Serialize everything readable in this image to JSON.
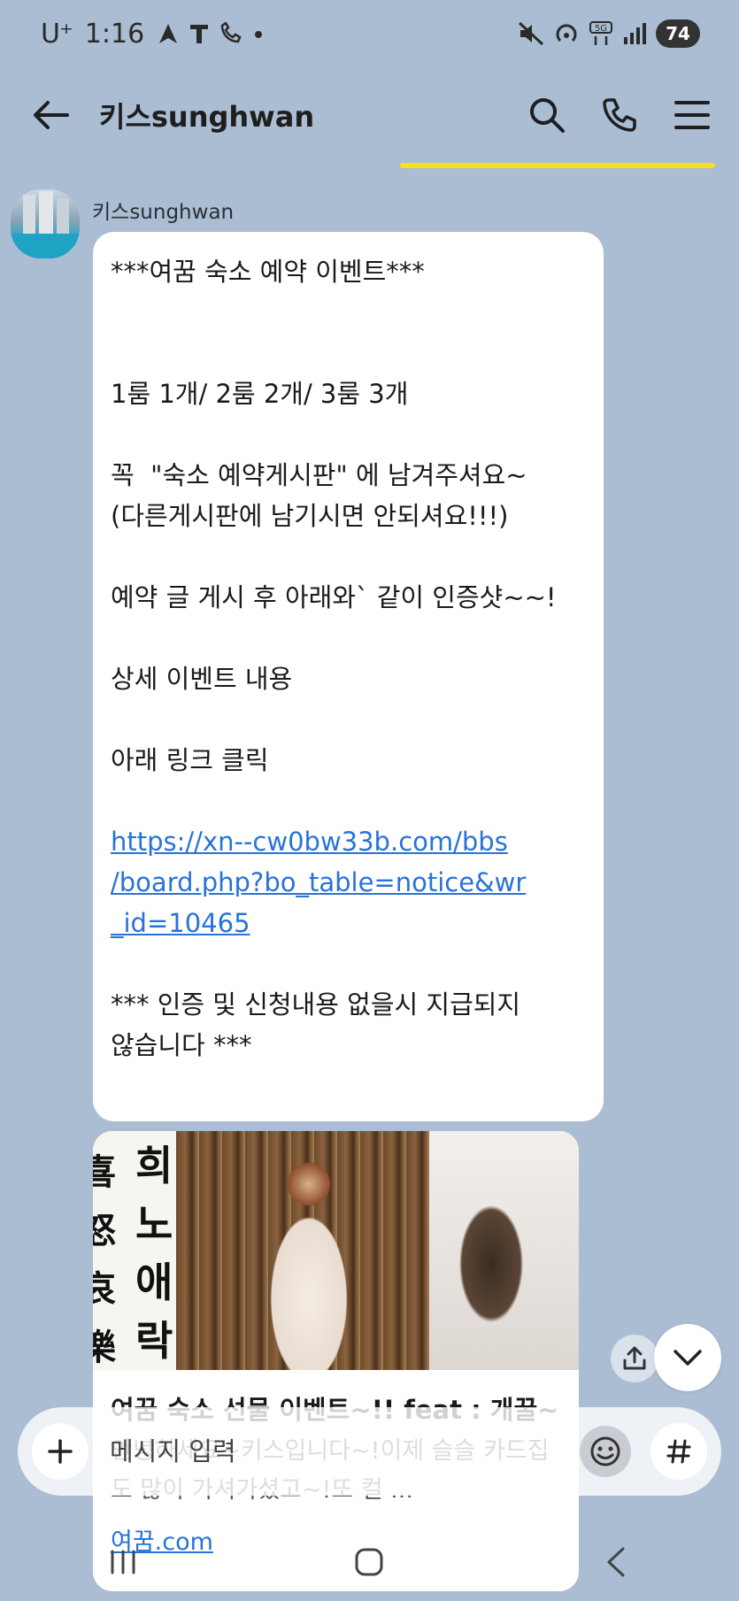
{
  "status_bar": {
    "carrier": "U⁺",
    "time": "1:16",
    "battery": "74",
    "colors": {
      "battery_bg": "#333333"
    }
  },
  "header": {
    "title": "키스sunghwan",
    "accent_color": "#f5e21c",
    "icons": [
      "back-arrow-icon",
      "search-icon",
      "phone-icon",
      "menu-icon"
    ]
  },
  "message": {
    "sender": "키스sunghwan",
    "lines": [
      "***여꿈 숙소 예약 이벤트***",
      "",
      "",
      "1룸 1개/ 2룸 2개/ 3룸 3개",
      "",
      "꼭  \"숙소 예약게시판\" 에 남겨주셔요~",
      "(다른게시판에 남기시면 안되셔요!!!)",
      "",
      "예약 글 게시 후 아래와` 같이 인증샷~~!",
      "",
      "상세 이벤트 내용",
      "",
      "아래 링크 클릭",
      ""
    ],
    "link_lines": [
      "https://xn--cw0bw33b.com/bbs",
      "/board.php?bo_table=notice&wr",
      "_id=10465"
    ],
    "footer_lines": [
      "",
      "*** 인증 및 신청내용 없을시 지급되지",
      "않습니다 ***"
    ],
    "link_color": "#2873d9"
  },
  "preview": {
    "calligraphy_a": "희노애락",
    "calligraphy_b": "喜怒哀樂",
    "title": "여꿈 숙소 선물 이벤트~!! feat : 개꿀~",
    "description": "안녕하세요~키스입니다~!이제 슬슬 카드집도 많이 가셔가셨고~!또 컬 ...",
    "domain": "여꿈.com"
  },
  "input": {
    "placeholder": "메시지 입력"
  },
  "nav": {
    "recents": "|||",
    "home": "◯",
    "back": "〈"
  }
}
